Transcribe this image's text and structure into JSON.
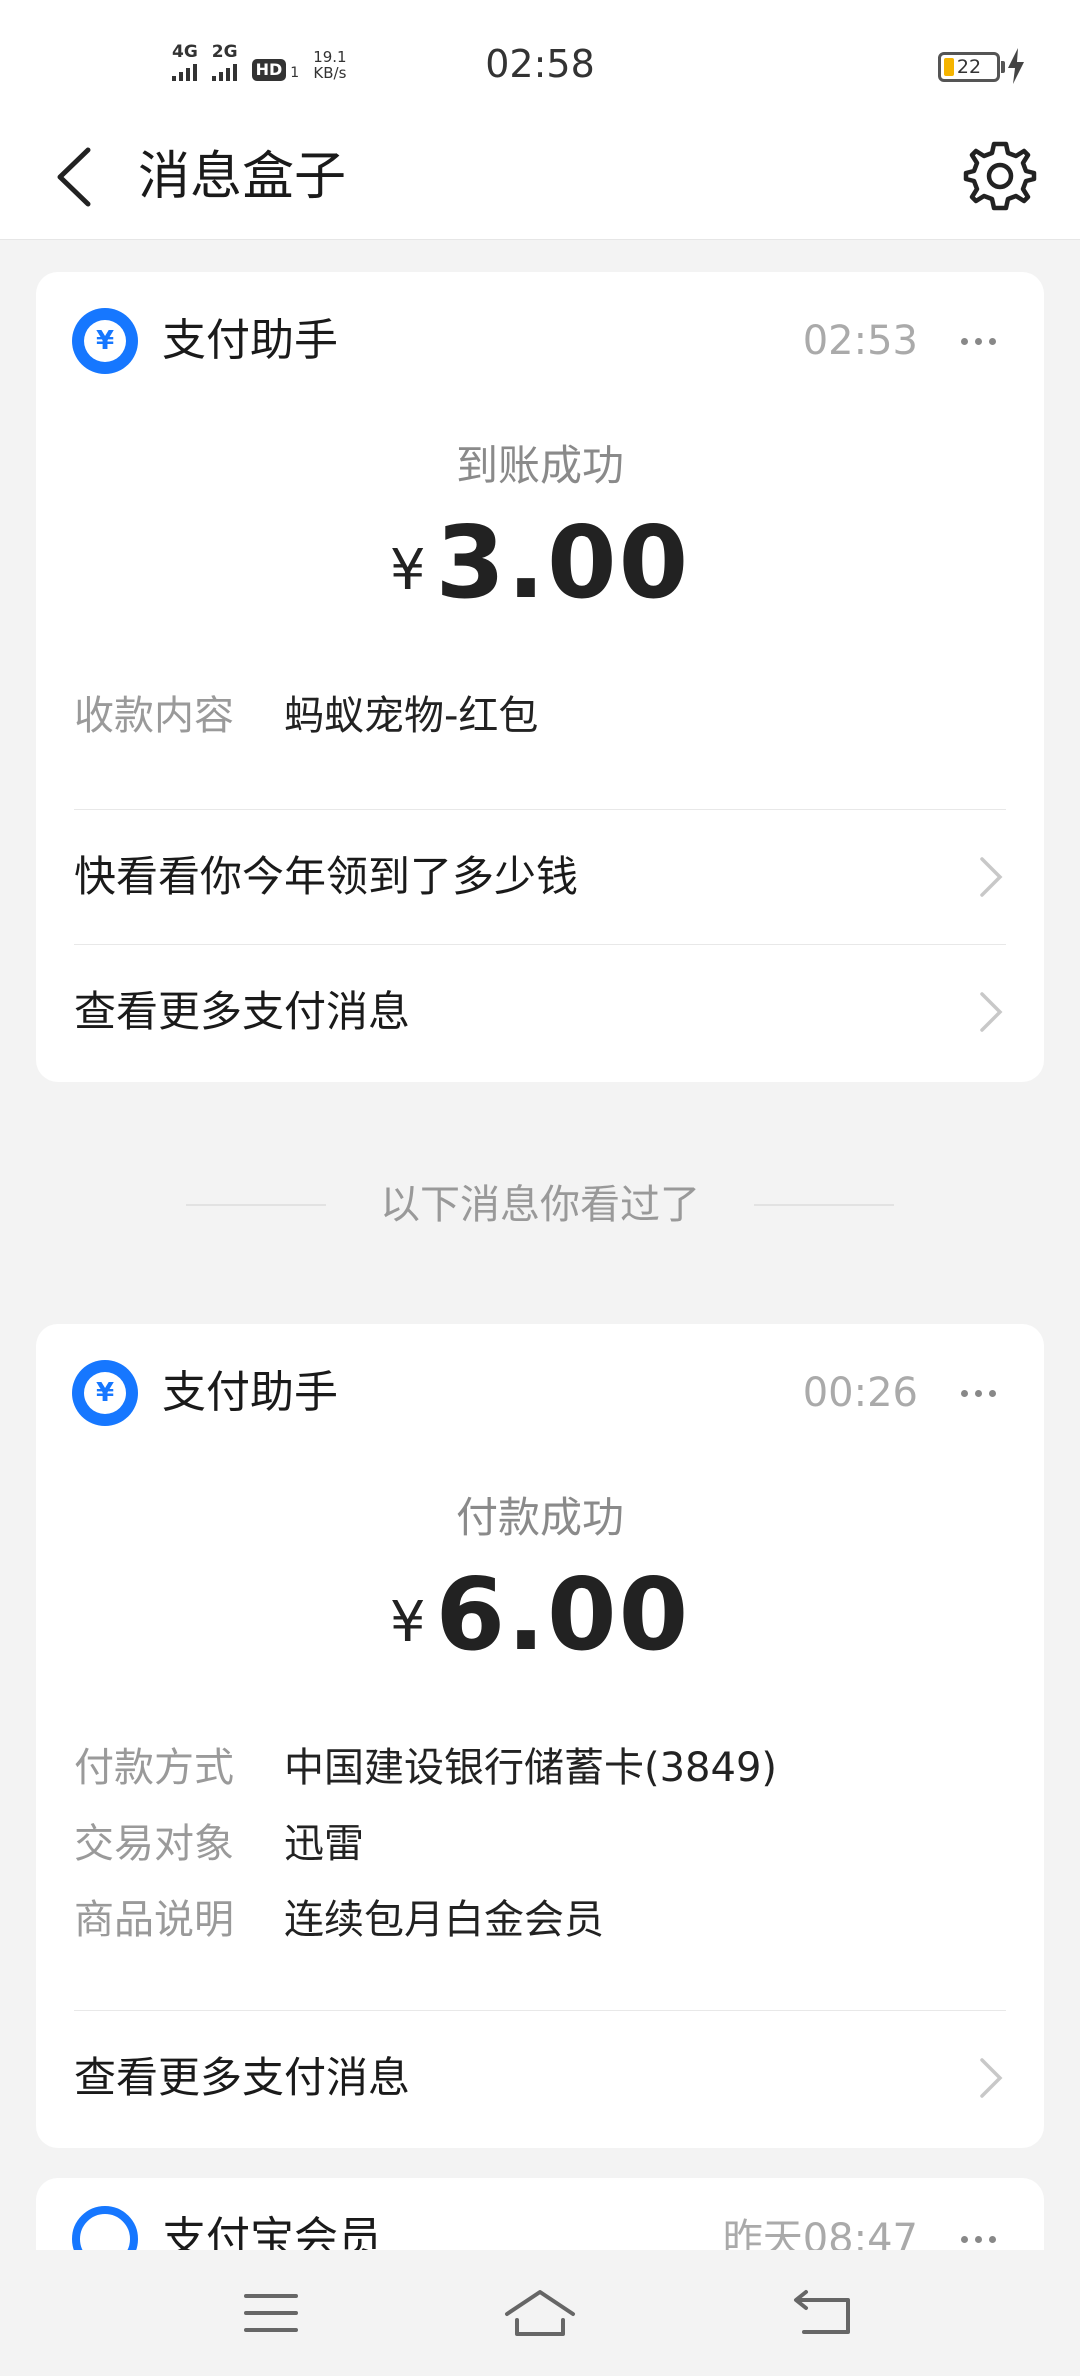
{
  "status_bar": {
    "net1": "4G",
    "net2": "2G",
    "hd": "HD",
    "hd_sub": "1",
    "speed_value": "19.1",
    "speed_unit": "KB/s",
    "time": "02:58",
    "battery": "22"
  },
  "nav": {
    "title": "消息盒子"
  },
  "cards": [
    {
      "app_name": "支付助手",
      "time": "02:53",
      "status": "到账成功",
      "currency": "¥",
      "amount": "3.00",
      "fields": [
        {
          "key": "收款内容",
          "value": "蚂蚁宠物-红包"
        }
      ],
      "links": [
        "快看看你今年领到了多少钱",
        "查看更多支付消息"
      ]
    },
    {
      "app_name": "支付助手",
      "time": "00:26",
      "status": "付款成功",
      "currency": "¥",
      "amount": "6.00",
      "fields": [
        {
          "key": "付款方式",
          "value": "中国建设银行储蓄卡(3849)"
        },
        {
          "key": "交易对象",
          "value": "迅雷"
        },
        {
          "key": "商品说明",
          "value": "连续包月白金会员"
        }
      ],
      "links": [
        "查看更多支付消息"
      ]
    }
  ],
  "divider_text": "以下消息你看过了",
  "peek_card": {
    "app_name": "支付宝会员",
    "time": "昨天08:47"
  },
  "colors": {
    "accent": "#1677ff",
    "background": "#f3f3f3",
    "battery": "#f5b400"
  }
}
